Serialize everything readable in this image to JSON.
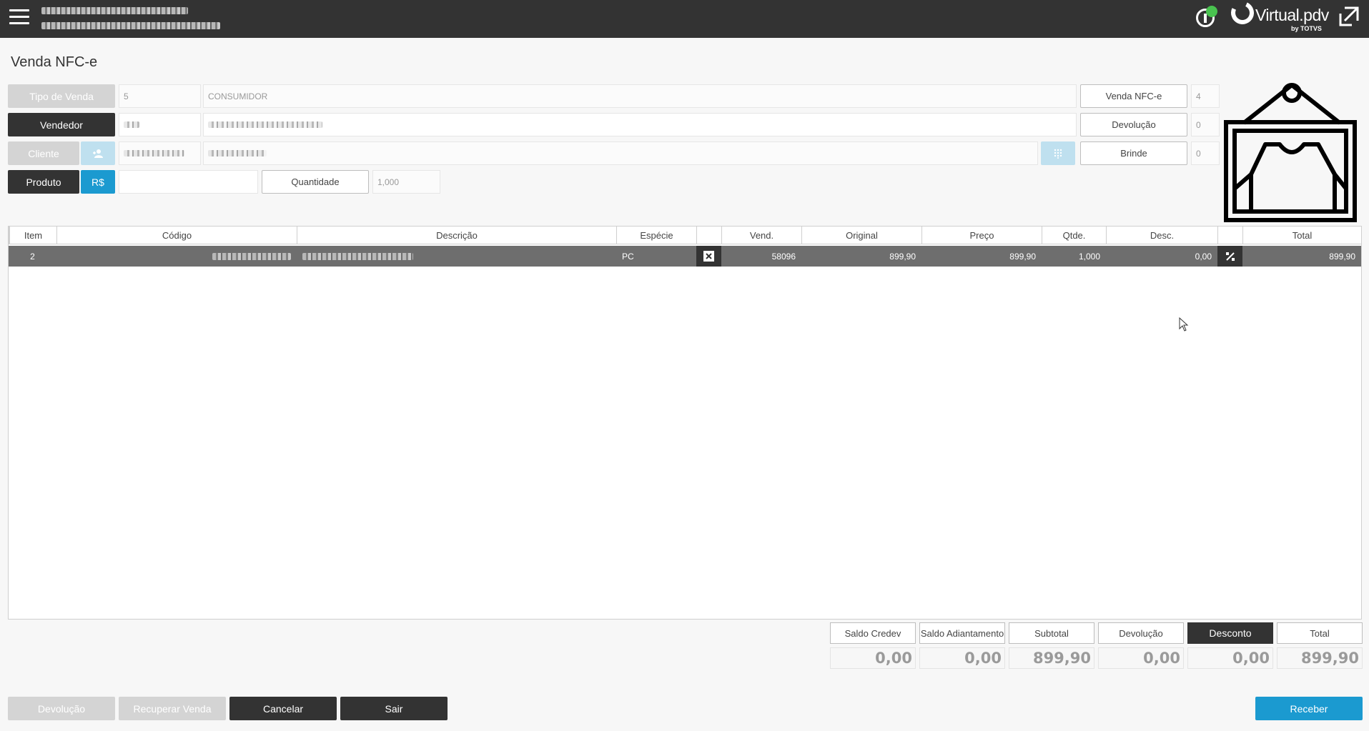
{
  "topbar": {
    "info_icon": "info-icon",
    "logo_text": "Virtual.pdv",
    "logo_sub": "by TOTVS",
    "status_color": "#49c24f"
  },
  "page": {
    "title": "Venda NFC-e"
  },
  "form": {
    "tipo_venda_label": "Tipo de Venda",
    "tipo_venda_code": "5",
    "tipo_venda_desc": "CONSUMIDOR",
    "vendedor_label": "Vendedor",
    "cliente_label": "Cliente",
    "produto_label": "Produto",
    "currency_label": "R$",
    "quantidade_label": "Quantidade",
    "quantidade_placeholder": "1,000"
  },
  "counters": [
    {
      "label": "Venda NFC-e",
      "value": "4"
    },
    {
      "label": "Devolução",
      "value": "0"
    },
    {
      "label": "Brinde",
      "value": "0"
    }
  ],
  "table": {
    "columns": [
      "Item",
      "Código",
      "Descrição",
      "Espécie",
      "",
      "Vend.",
      "Original",
      "Preço",
      "Qtde.",
      "Desc.",
      "",
      "Total"
    ],
    "rows": [
      {
        "item": "2",
        "especie": "PC",
        "vend": "58096",
        "original": "899,90",
        "preco": "899,90",
        "qtde": "1,000",
        "desc": "0,00",
        "total": "899,90"
      }
    ]
  },
  "totals": [
    {
      "label": "Saldo Credev",
      "value": "0,00"
    },
    {
      "label": "Saldo Adiantamento",
      "value": "0,00"
    },
    {
      "label": "Subtotal",
      "value": "899,90"
    },
    {
      "label": "Devolução",
      "value": "0,00"
    },
    {
      "label": "Desconto",
      "value": "0,00"
    },
    {
      "label": "Total",
      "value": "899,90"
    }
  ],
  "footer": {
    "devolucao": "Devolução",
    "recuperar": "Recuperar Venda",
    "cancelar": "Cancelar",
    "sair": "Sair",
    "receber": "Receber"
  }
}
